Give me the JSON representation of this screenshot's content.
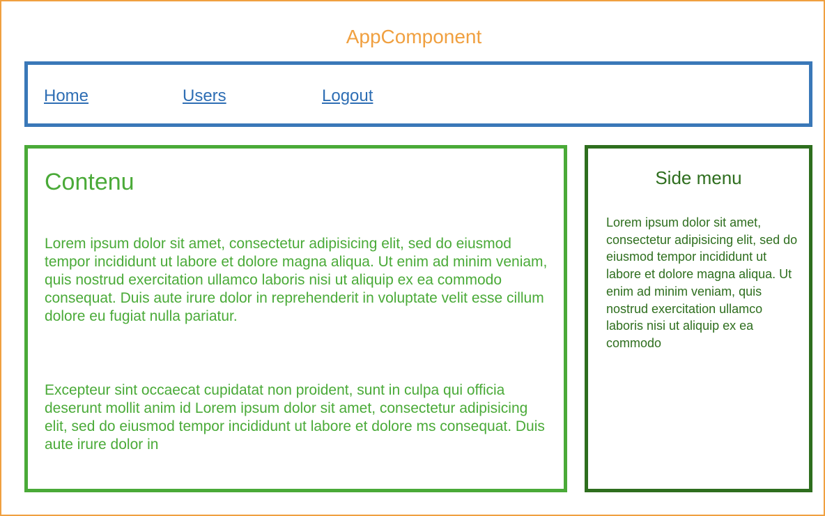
{
  "app": {
    "title": "AppComponent"
  },
  "nav": {
    "links": [
      {
        "label": "Home"
      },
      {
        "label": "Users"
      },
      {
        "label": "Logout"
      }
    ]
  },
  "content": {
    "title": "Contenu",
    "paragraphs": [
      "Lorem ipsum dolor sit amet, consectetur adipisicing elit, sed do eiusmod tempor incididunt ut labore et dolore magna aliqua. Ut enim ad minim veniam, quis nostrud exercitation ullamco laboris nisi ut aliquip ex ea commodo consequat. Duis aute irure dolor in reprehenderit in voluptate velit esse cillum dolore eu fugiat nulla pariatur.",
      "Excepteur sint occaecat cupidatat non proident, sunt in culpa qui officia deserunt mollit anim id Lorem ipsum dolor sit amet, consectetur adipisicing elit, sed do eiusmod tempor incididunt ut labore et dolore ms consequat. Duis aute irure dolor in"
    ]
  },
  "side_menu": {
    "title": "Side menu",
    "text": "Lorem ipsum dolor sit amet, consectetur adipisicing elit, sed do eiusmod tempor incididunt ut labore et dolore magna aliqua. Ut enim ad minim veniam, quis nostrud exercitation ullamco laboris nisi ut aliquip ex ea commodo"
  },
  "colors": {
    "app_border": "#f0a040",
    "nav_border": "#3a78b8",
    "nav_link": "#2e6eb4",
    "content_accent": "#4aaa38",
    "side_accent": "#2e6e1e"
  }
}
